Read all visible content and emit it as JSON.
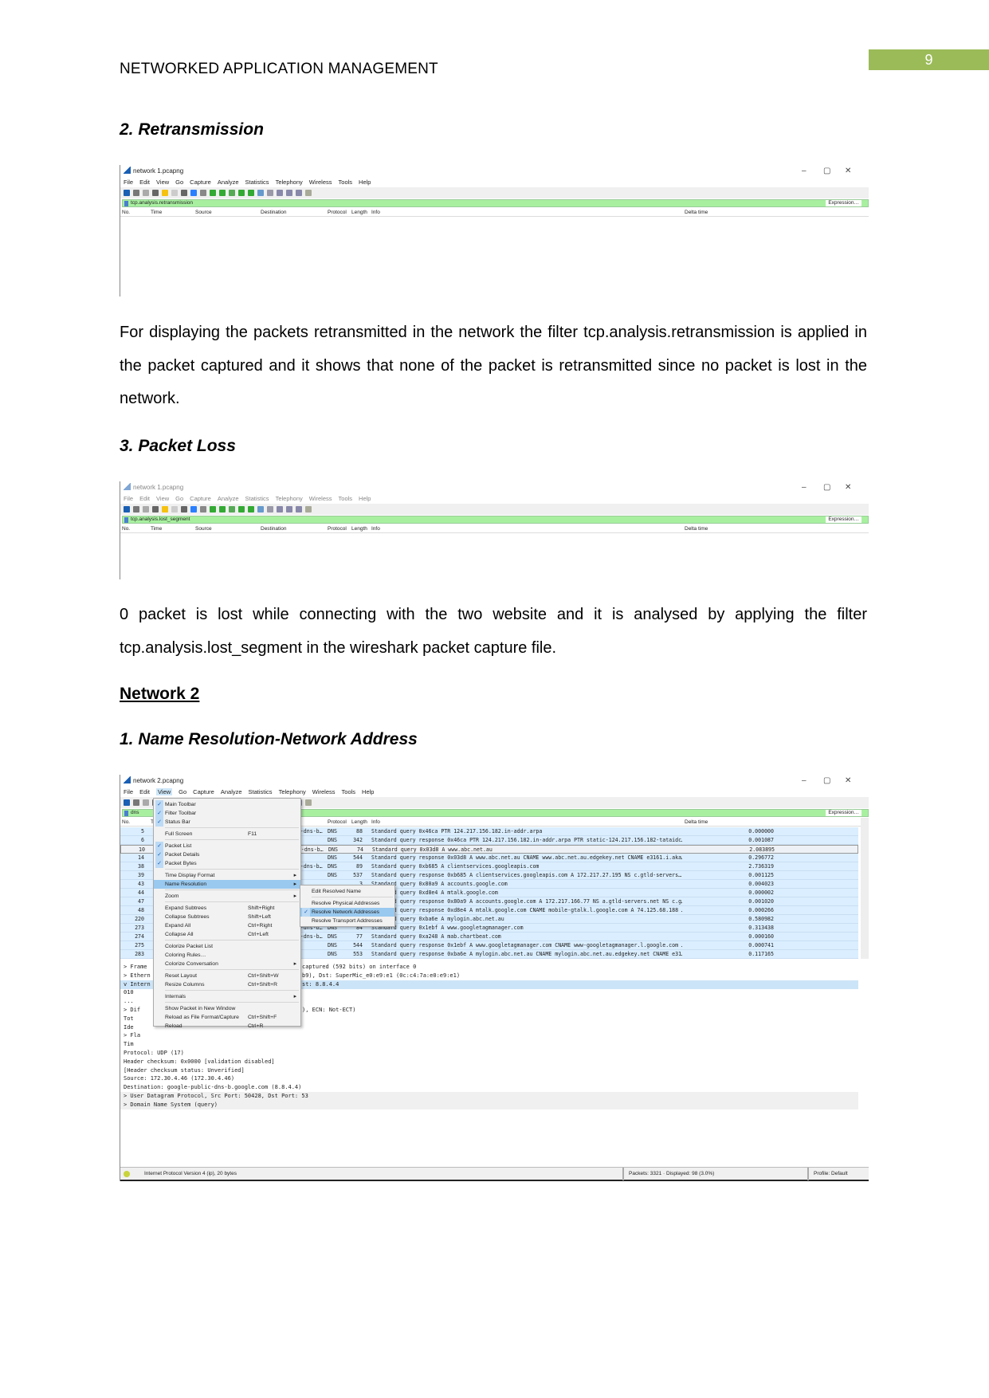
{
  "page_number": "9",
  "running_header": "NETWORKED APPLICATION MANAGEMENT",
  "section_retrans": {
    "heading": "2. Retransmission",
    "paragraph": "For displaying the packets retransmitted in the network the filter tcp.analysis.retransmission is applied in the packet captured and it shows that none of the packet is retransmitted since no packet is lost in the network."
  },
  "section_loss": {
    "heading": "3. Packet Loss",
    "paragraph": "0 packet is lost while connecting with the two website and it is analysed by applying the filter tcp.analysis.lost_segment in the wireshark packet capture file."
  },
  "network2_heading": "Network 2",
  "section_nameres": {
    "heading": "1. Name Resolution-Network Address"
  },
  "wireshark": {
    "menu": [
      "File",
      "Edit",
      "View",
      "Go",
      "Capture",
      "Analyze",
      "Statistics",
      "Telephony",
      "Wireless",
      "Tools",
      "Help"
    ],
    "columns": {
      "no": "No.",
      "time": "Time",
      "source": "Source",
      "destination": "Destination",
      "protocol": "Protocol",
      "length": "Length",
      "info": "Info",
      "delta": "Delta time"
    },
    "expression_label": "Expression…",
    "window_controls": [
      "–",
      "▢",
      "✕"
    ]
  },
  "capture1": {
    "title": "network 1.pcapng",
    "filter": "tcp.analysis.retransmission"
  },
  "capture2": {
    "title": "network 1.pcapng",
    "filter": "tcp.analysis.lost_segment"
  },
  "capture3": {
    "title": "network 2.pcapng",
    "filter": "dns",
    "packets": [
      {
        "no": "5",
        "dst": "public-dns-b…",
        "proto": "DNS",
        "len": "88",
        "info": "Standard query 0x46ca PTR 124.217.156.182.in-addr.arpa",
        "delta": "0.000000"
      },
      {
        "no": "6",
        "dst": "4.46",
        "proto": "DNS",
        "len": "342",
        "info": "Standard query response 0x46ca PTR 124.217.156.182.in-addr.arpa PTR static-124.217.156.182-tataidc…",
        "delta": "0.001087"
      },
      {
        "no": "10",
        "dst": "public-dns-b…",
        "proto": "DNS",
        "len": "74",
        "info": "Standard query 0x03d8 A www.abc.net.au",
        "delta": "2.083895"
      },
      {
        "no": "14",
        "dst": "4.46",
        "proto": "DNS",
        "len": "544",
        "info": "Standard query response 0x03d8 A www.abc.net.au CNAME www.abc.net.au.edgekey.net CNAME e3161.i.aka…",
        "delta": "0.296772"
      },
      {
        "no": "38",
        "dst": "public-dns-b…",
        "proto": "DNS",
        "len": "89",
        "info": "Standard query 0xb685 A clientservices.googleapis.com",
        "delta": "2.736319"
      },
      {
        "no": "39",
        "dst": "4.46",
        "proto": "DNS",
        "len": "537",
        "info": "Standard query response 0xb685 A clientservices.googleapis.com A 172.217.27.195 NS c.gtld-servers…",
        "delta": "0.001125"
      },
      {
        "no": "43",
        "dst": "",
        "proto": "",
        "len": "3",
        "info": "Standard query 0x80a9 A accounts.google.com",
        "delta": "0.004023"
      },
      {
        "no": "44",
        "dst": "",
        "proto": "",
        "len": "5",
        "info": "Standard query 0xd8e4 A mtalk.google.com",
        "delta": "0.000002"
      },
      {
        "no": "47",
        "dst": "",
        "proto": "",
        "len": "7",
        "info": "Standard query response 0x80a9 A accounts.google.com A 172.217.166.77 NS a.gtld-servers.net NS c.g…",
        "delta": "0.001020"
      },
      {
        "no": "48",
        "dst": "",
        "proto": "",
        "len": "3",
        "info": "Standard query response 0xd8e4 A mtalk.google.com CNAME mobile-gtalk.l.google.com A 74.125.68.188 …",
        "delta": "0.000266"
      },
      {
        "no": "220",
        "dst": "",
        "proto": "",
        "len": "3",
        "info": "Standard query 0xba6e A mylogin.abc.net.au",
        "delta": "0.580982"
      },
      {
        "no": "273",
        "dst": "public-dns-b…",
        "proto": "DNS",
        "len": "84",
        "info": "Standard query 0x1ebf A www.googletagmanager.com",
        "delta": "0.313438"
      },
      {
        "no": "274",
        "dst": "public-dns-b…",
        "proto": "DNS",
        "len": "77",
        "info": "Standard query 0xa248 A mab.chartbeat.com",
        "delta": "0.000160"
      },
      {
        "no": "275",
        "dst": "4.46",
        "proto": "DNS",
        "len": "544",
        "info": "Standard query response 0x1ebf A www.googletagmanager.com CNAME www-googletagmanager.l.google.com …",
        "delta": "0.000741"
      },
      {
        "no": "283",
        "dst": "4.46",
        "proto": "DNS",
        "len": "553",
        "info": "Standard query response 0xba6e A mylogin.abc.net.au CNAME mylogin.abc.net.au.edgekey.net CNAME e31…",
        "delta": "0.117165"
      }
    ],
    "details": [
      {
        "l": "> Frame",
        "r": "captured (592 bits) on interface 0"
      },
      {
        "l": "> Ethern",
        "r": "b9), Dst: SuperMic_e0:e9:e1 (0c:c4:7a:e0:e9:e1)"
      },
      {
        "l": "v Intern",
        "r": "st: 8.8.4.4",
        "hl": true
      },
      {
        "l": "    010",
        "r": ""
      },
      {
        "l": "    ...",
        "r": ""
      },
      {
        "l": "  > Dif",
        "r": "), ECN: Not-ECT)"
      },
      {
        "l": "    Tot",
        "r": ""
      },
      {
        "l": "    Ide",
        "r": ""
      },
      {
        "l": "  > Fla",
        "r": ""
      },
      {
        "l": "    Tim",
        "r": ""
      },
      {
        "l": "    Protocol: UDP (17)",
        "r": ""
      },
      {
        "l": "    Header checksum: 0x0000 [validation disabled]",
        "r": ""
      },
      {
        "l": "    [Header checksum status: Unverified]",
        "r": ""
      },
      {
        "l": "    Source: 172.30.4.46 (172.30.4.46)",
        "r": ""
      },
      {
        "l": "    Destination: google-public-dns-b.google.com (8.8.4.4)",
        "r": ""
      },
      {
        "l": "> User Datagram Protocol, Src Port: 50428, Dst Port: 53",
        "r": "",
        "gr": true
      },
      {
        "l": "> Domain Name System (query)",
        "r": "",
        "gr": true
      }
    ],
    "view_menu": [
      {
        "label": "Main Toolbar",
        "checked": true
      },
      {
        "label": "Filter Toolbar",
        "checked": true
      },
      {
        "label": "Status Bar",
        "checked": true
      },
      {
        "sep": true
      },
      {
        "label": "Full Screen",
        "shortcut": "F11"
      },
      {
        "sep": true
      },
      {
        "label": "Packet List",
        "checked": true
      },
      {
        "label": "Packet Details",
        "checked": true
      },
      {
        "label": "Packet Bytes",
        "checked": true
      },
      {
        "sep": true
      },
      {
        "label": "Time Display Format",
        "submenu": true
      },
      {
        "label": "Name Resolution",
        "submenu": true,
        "active": true
      },
      {
        "sep": true
      },
      {
        "label": "Zoom",
        "submenu": true
      },
      {
        "sep": true
      },
      {
        "label": "Expand Subtrees",
        "shortcut": "Shift+Right"
      },
      {
        "label": "Collapse Subtrees",
        "shortcut": "Shift+Left"
      },
      {
        "label": "Expand All",
        "shortcut": "Ctrl+Right"
      },
      {
        "label": "Collapse All",
        "shortcut": "Ctrl+Left"
      },
      {
        "sep": true
      },
      {
        "label": "Colorize Packet List"
      },
      {
        "label": "Coloring Rules…"
      },
      {
        "label": "Colorize Conversation",
        "submenu": true
      },
      {
        "sep": true
      },
      {
        "label": "Reset Layout",
        "shortcut": "Ctrl+Shift+W"
      },
      {
        "label": "Resize Columns",
        "shortcut": "Ctrl+Shift+R"
      },
      {
        "sep": true
      },
      {
        "label": "Internals",
        "submenu": true
      },
      {
        "sep": true
      },
      {
        "label": "Show Packet in New Window"
      },
      {
        "label": "Reload as File Format/Capture",
        "shortcut": "Ctrl+Shift+F"
      },
      {
        "label": "Reload",
        "shortcut": "Ctrl+R"
      }
    ],
    "name_resolution_menu": [
      {
        "label": "Edit Resolved Name"
      },
      {
        "sep": true
      },
      {
        "label": "Resolve Physical Addresses"
      },
      {
        "label": "Resolve Network Addresses",
        "checked": true,
        "active": true
      },
      {
        "label": "Resolve Transport Addresses"
      }
    ],
    "status": {
      "left": "Internet Protocol Version 4 (ip), 20 bytes",
      "packets": "Packets: 3321 · Displayed: 98 (3.0%)",
      "profile": "Profile: Default"
    }
  }
}
